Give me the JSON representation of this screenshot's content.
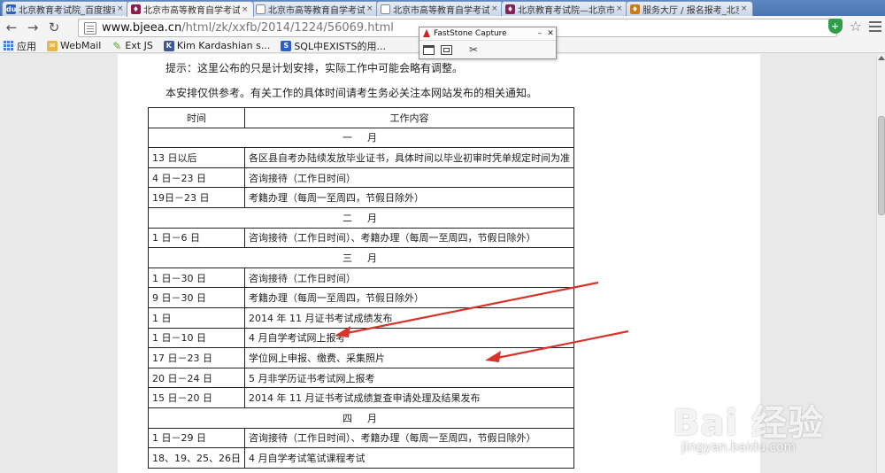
{
  "browser": {
    "tabs": [
      {
        "label": "北京教育考试院_百度搜索",
        "icon": "baidu-icon",
        "active": false
      },
      {
        "label": "北京市高等教育自学考试...",
        "icon": "edu-icon",
        "active": true
      },
      {
        "label": "北京市高等教育自学考试",
        "icon": "page-icon",
        "active": false
      },
      {
        "label": "北京市高等教育自学考试",
        "icon": "page-icon",
        "active": false
      },
      {
        "label": "北京教育考试院—北京市",
        "icon": "edu-icon",
        "active": false
      },
      {
        "label": "服务大厅 / 报名报考_北京",
        "icon": "service-icon",
        "active": false
      }
    ],
    "address": {
      "host": "www.bjeea.cn",
      "path": "/html/zk/xxfb/2014/1224/56069.html"
    },
    "bookmarks": [
      {
        "label": "应用",
        "icon": "apps-grid-icon"
      },
      {
        "label": "WebMail",
        "icon": "mail-icon"
      },
      {
        "label": "Ext JS",
        "icon": "extjs-icon"
      },
      {
        "label": "Kim Kardashian s...",
        "icon": "kim-icon"
      },
      {
        "label": "SQL中EXISTS的用...",
        "icon": "sql-icon"
      }
    ]
  },
  "capture_tool": {
    "title": "FastStone Capture"
  },
  "page": {
    "tip": "提示：这里公布的只是计划安排，实际工作中可能会略有调整。",
    "notice": "本安排仅供参考。有关工作的具体时间请考生务必关注本网站发布的相关通知。",
    "table": {
      "headers": [
        "时间",
        "工作内容"
      ],
      "rows": [
        {
          "month": "一　月"
        },
        {
          "time": "13 日以后",
          "task": "各区县自考办陆续发放毕业证书，具体时间以毕业初审时凭单规定时间为准"
        },
        {
          "time": "4 日－23 日",
          "task": "咨询接待（工作日时间）"
        },
        {
          "time": "19日－23 日",
          "task": "考籍办理（每周一至周四，节假日除外）"
        },
        {
          "month": "二　月"
        },
        {
          "time": "1 日－6 日",
          "task": "咨询接待（工作日时间）、考籍办理（每周一至周四，节假日除外）"
        },
        {
          "month": "三　月"
        },
        {
          "time": "1 日－30 日",
          "task": "咨询接待（工作日时间）"
        },
        {
          "time": "9 日－30 日",
          "task": "考籍办理（每周一至周四，节假日除外）"
        },
        {
          "time": "1 日",
          "task": "2014 年 11 月证书考试成绩发布"
        },
        {
          "time": "1 日－10 日",
          "task": "4 月自学考试网上报考"
        },
        {
          "time": "17 日－23 日",
          "task": "学位网上申报、缴费、采集照片"
        },
        {
          "time": "20 日－24 日",
          "task": "5 月非学历证书考试网上报考"
        },
        {
          "time": "15 日－20 日",
          "task": "2014 年 11 月证书考试成绩复查申请处理及结果发布"
        },
        {
          "month": "四　月"
        },
        {
          "time": "1 日－29 日",
          "task": "咨询接待（工作日时间）、考籍办理（每周一至周四，节假日除外）"
        },
        {
          "time": "18、19、25、26日",
          "task": "4 月自学考试笔试课程考试"
        }
      ]
    }
  },
  "watermark": {
    "logo": "Bai 经验",
    "url": "jingyan.baidu.com"
  },
  "colors": {
    "arrow": "#d9342b",
    "tabstrip": "#4a74b0",
    "ext_icon": "#2f9c47"
  }
}
